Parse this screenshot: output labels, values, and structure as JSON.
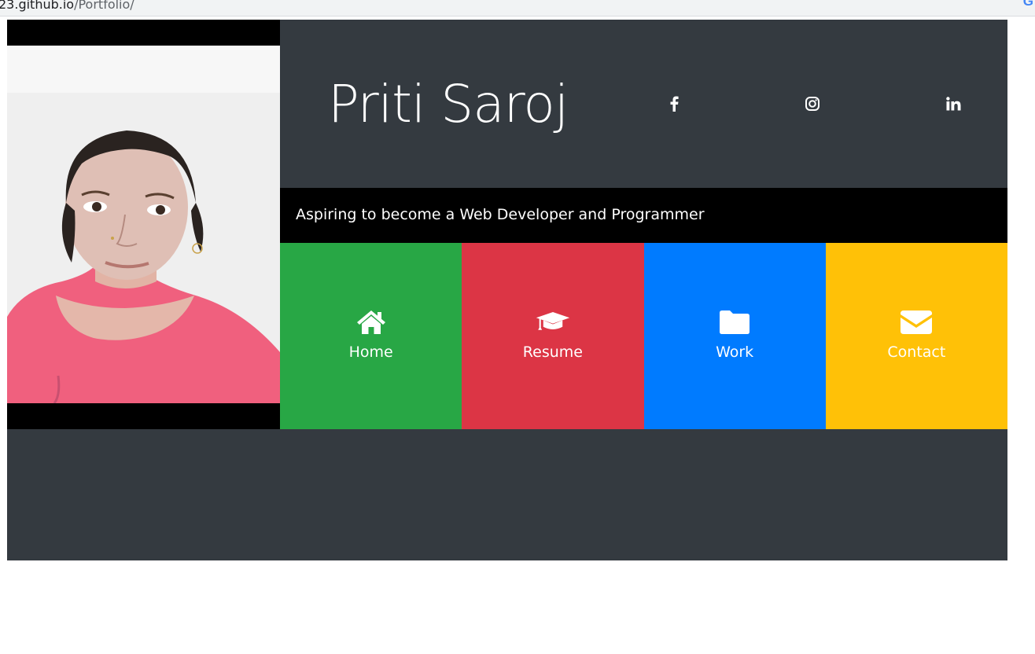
{
  "browser": {
    "url_host": "23.github.io",
    "url_path": "/Portfolio/",
    "search_icon": "google-g-icon"
  },
  "profile": {
    "name": "Priti Saroj",
    "tagline": "Aspiring to become a Web Developer and Programmer",
    "photo_icon": "profile-photo"
  },
  "social": [
    {
      "name": "facebook",
      "icon": "facebook-icon"
    },
    {
      "name": "instagram",
      "icon": "instagram-icon"
    },
    {
      "name": "linkedin",
      "icon": "linkedin-icon"
    }
  ],
  "nav": [
    {
      "label": "Home",
      "icon": "home-icon",
      "color": "#28a745"
    },
    {
      "label": "Resume",
      "icon": "graduation-cap-icon",
      "color": "#dc3545"
    },
    {
      "label": "Work",
      "icon": "folder-icon",
      "color": "#007bff"
    },
    {
      "label": "Contact",
      "icon": "envelope-icon",
      "color": "#ffc107"
    }
  ],
  "colors": {
    "page_background": "#343a40",
    "tagline_background": "#000000"
  }
}
